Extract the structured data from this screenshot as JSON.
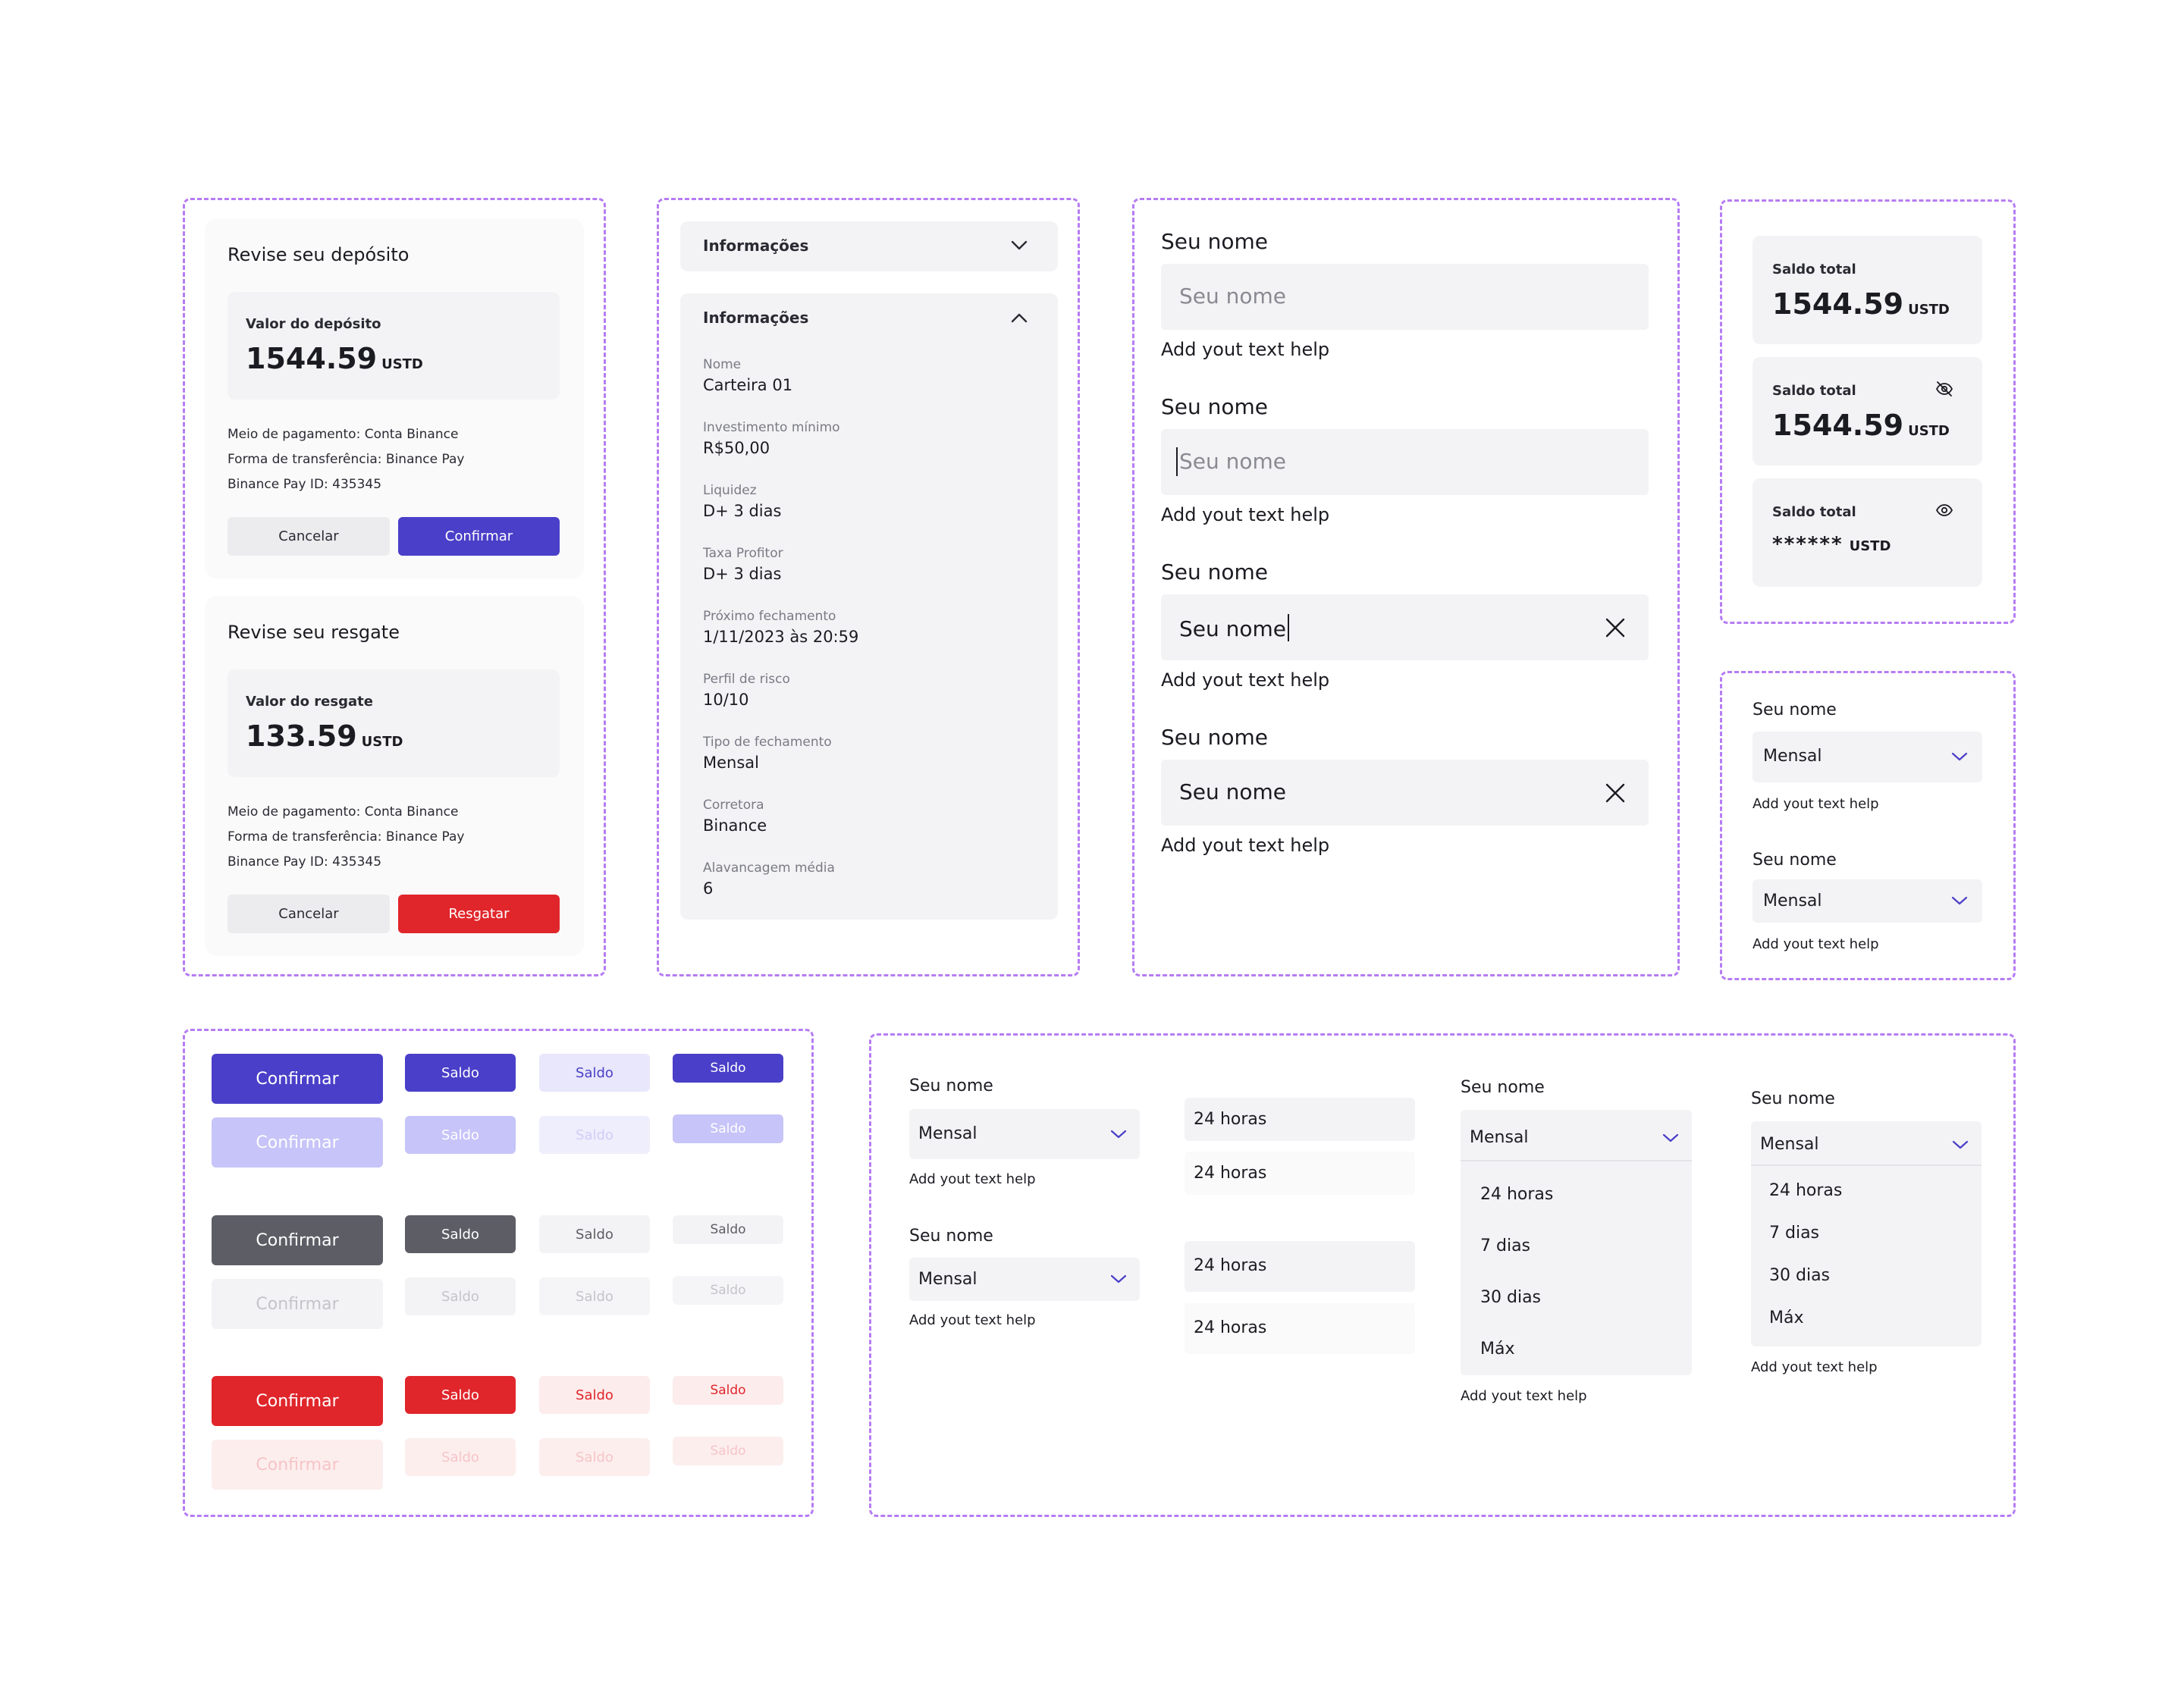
{
  "deposit": {
    "title": "Revise seu depósito",
    "value_label": "Valor do depósito",
    "amount": "1544.59",
    "currency": "USTD",
    "payment_label": "Meio de pagamento:",
    "payment_value": "Conta Binance",
    "transfer_label": "Forma de transferência:",
    "transfer_value": "Binance Pay",
    "id_label": "Binance Pay ID:",
    "id_value": "435345",
    "cancel": "Cancelar",
    "confirm": "Confirmar"
  },
  "rescue": {
    "title": "Revise seu resgate",
    "value_label": "Valor do resgate",
    "amount": "133.59",
    "currency": "USTD",
    "payment_label": "Meio de pagamento:",
    "payment_value": "Conta Binance",
    "transfer_label": "Forma de transferência:",
    "transfer_value": "Binance Pay",
    "id_label": "Binance Pay ID:",
    "id_value": "435345",
    "cancel": "Cancelar",
    "confirm": "Resgatar"
  },
  "accordion": {
    "collapsed_title": "Informações",
    "expanded_title": "Informações",
    "items": [
      {
        "key": "Nome",
        "value": "Carteira 01"
      },
      {
        "key": "Investimento mínimo",
        "value": "R$50,00"
      },
      {
        "key": "Liquidez",
        "value": "D+ 3 dias"
      },
      {
        "key": "Taxa Profitor",
        "value": "D+ 3 dias"
      },
      {
        "key": "Próximo fechamento",
        "value": "1/11/2023 às 20:59"
      },
      {
        "key": "Perfil de risco",
        "value": "10/10"
      },
      {
        "key": "Tipo de fechamento",
        "value": "Mensal"
      },
      {
        "key": "Corretora",
        "value": "Binance"
      },
      {
        "key": "Alavancagem média",
        "value": "6"
      }
    ]
  },
  "inputs": [
    {
      "label": "Seu nome",
      "value": "Seu nome",
      "help": "Add yout text help"
    },
    {
      "label": "Seu nome",
      "value": "Seu nome",
      "help": "Add yout text help"
    },
    {
      "label": "Seu nome",
      "value": "Seu nome",
      "help": "Add yout text help"
    },
    {
      "label": "Seu nome",
      "value": "Seu nome",
      "help": "Add yout text help"
    }
  ],
  "balances": [
    {
      "label": "Saldo total",
      "value": "1544.59",
      "currency": "USTD"
    },
    {
      "label": "Saldo total",
      "value": "1544.59",
      "currency": "USTD"
    },
    {
      "label": "Saldo total",
      "value": "******",
      "currency": "USTD"
    }
  ],
  "small_selects": [
    {
      "label": "Seu nome",
      "value": "Mensal",
      "help": "Add yout text help"
    },
    {
      "label": "Seu nome",
      "value": "Mensal",
      "help": "Add yout text help"
    }
  ],
  "buttons": {
    "primary": "Confirmar",
    "small": "Saldo"
  },
  "select_showcase": {
    "selects": [
      {
        "label": "Seu nome",
        "value": "Mensal",
        "help": "Add yout text help"
      },
      {
        "label": "Seu nome",
        "value": "Mensal",
        "help": "Add yout text help"
      }
    ],
    "option_items": [
      "24 horas",
      "24 horas",
      "24 horas",
      "24 horas"
    ],
    "dropdown_a": {
      "label": "Seu nome",
      "value": "Mensal",
      "options": [
        "24 horas",
        "7 dias",
        "30 dias",
        "Máx"
      ],
      "help": "Add yout text help"
    },
    "dropdown_b": {
      "label": "Seu nome",
      "value": "Mensal",
      "options": [
        "24 horas",
        "7 dias",
        "30 dias",
        "Máx"
      ],
      "help": "Add yout text help"
    }
  },
  "colors": {
    "frame": "#b67cf3",
    "primary": "#4a3fc8",
    "danger": "#e0262b",
    "neutral": "#5d5d66",
    "surface": "#f3f3f5"
  }
}
